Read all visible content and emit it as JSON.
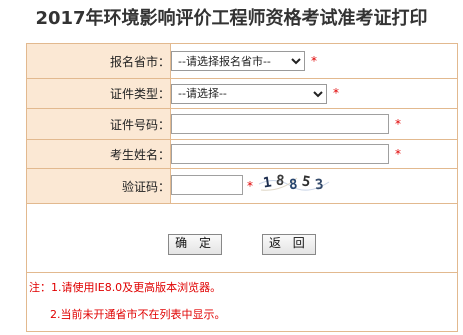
{
  "page": {
    "title": "2017年环境影响评价工程师资格考试准考证打印"
  },
  "form": {
    "province": {
      "label": "报名省市：",
      "selected": "--请选择报名省市--",
      "required_mark": "*"
    },
    "id_type": {
      "label": "证件类型：",
      "selected": "--请选择--",
      "required_mark": "*"
    },
    "id_number": {
      "label": "证件号码：",
      "value": "",
      "required_mark": "*"
    },
    "name": {
      "label": "考生姓名：",
      "value": "",
      "required_mark": "*"
    },
    "captcha": {
      "label": "验证码：",
      "value": "",
      "required_mark": "*",
      "image_text": "18853"
    },
    "buttons": {
      "confirm": "确 定",
      "back": "返 回"
    }
  },
  "notes": {
    "line1": "注：1.请使用IE8.0及更高版本浏览器。",
    "line2": "2.当前未开通省市不在列表中显示。"
  },
  "colors": {
    "label_bg": "#fbe8d4",
    "border": "#e2b98f",
    "required": "#e00000",
    "note_text": "#e00000"
  }
}
